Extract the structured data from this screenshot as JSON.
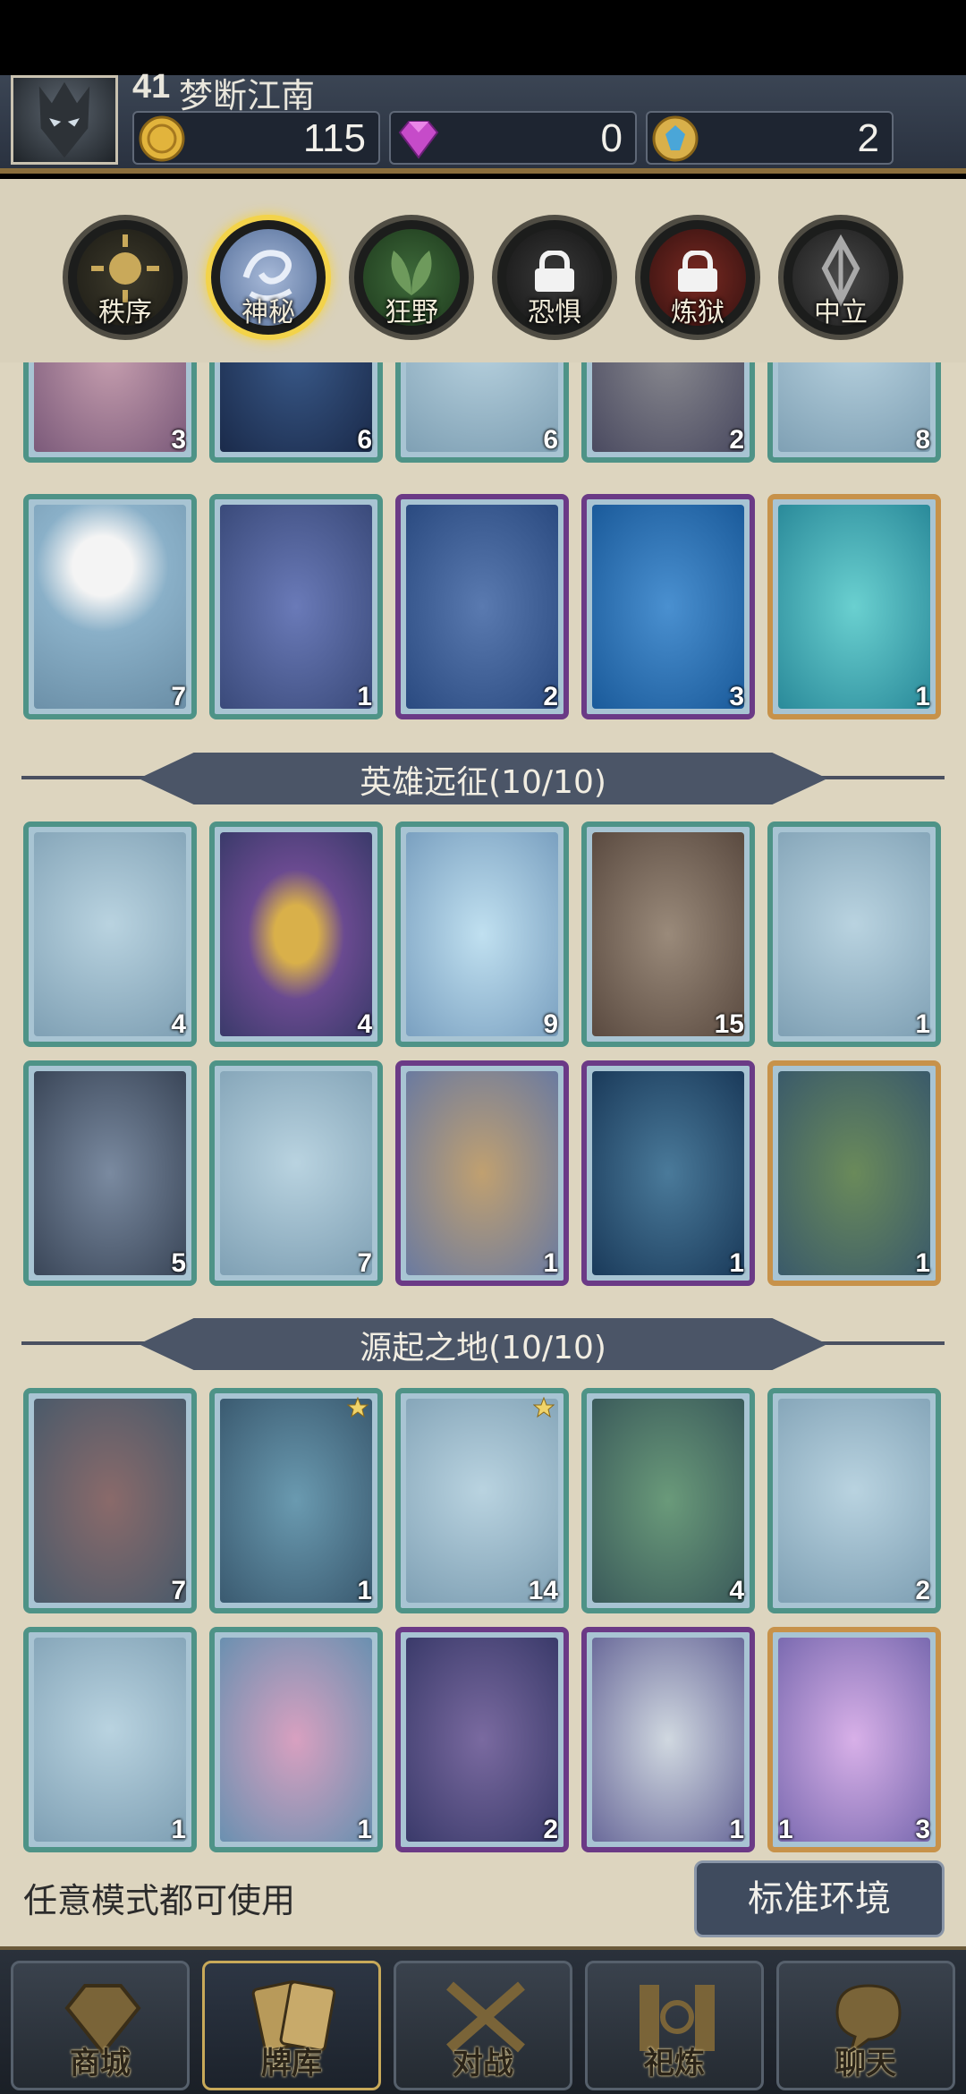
{
  "player": {
    "level": "41",
    "name": "梦断江南"
  },
  "resources": {
    "gold": "115",
    "gems": "0",
    "crystals": "2"
  },
  "factions": [
    {
      "label": "秩序",
      "locked": false,
      "active": false
    },
    {
      "label": "神秘",
      "locked": false,
      "active": true
    },
    {
      "label": "狂野",
      "locked": false,
      "active": false
    },
    {
      "label": "恐惧",
      "locked": true,
      "active": false
    },
    {
      "label": "炼狱",
      "locked": true,
      "active": false
    },
    {
      "label": "中立",
      "locked": false,
      "active": false
    }
  ],
  "partial_row": {
    "counts": [
      "3",
      "6",
      "6",
      "2",
      "8"
    ]
  },
  "set_prev_row2": {
    "counts": [
      "7",
      "1",
      "2",
      "3",
      "1"
    ],
    "rarity": [
      "common",
      "common",
      "epic",
      "epic",
      "legend"
    ]
  },
  "sections": [
    {
      "title": "英雄远征(10/10)",
      "rows": [
        {
          "counts": [
            "4",
            "4",
            "9",
            "15",
            "1"
          ],
          "rarity": [
            "common",
            "common",
            "common",
            "common",
            "common"
          ]
        },
        {
          "counts": [
            "5",
            "7",
            "1",
            "1",
            "1"
          ],
          "rarity": [
            "common",
            "common",
            "epic",
            "epic",
            "legend"
          ]
        }
      ]
    },
    {
      "title": "源起之地(10/10)",
      "rows": [
        {
          "counts": [
            "7",
            "1",
            "14",
            "4",
            "2"
          ],
          "rarity": [
            "common",
            "common",
            "common",
            "common",
            "common"
          ],
          "starred": [
            false,
            true,
            true,
            false,
            false
          ]
        },
        {
          "counts": [
            "1",
            "1",
            "2",
            "1",
            "3"
          ],
          "rarity": [
            "common",
            "common",
            "epic",
            "epic",
            "legend"
          ],
          "left_count_last": "1"
        }
      ]
    }
  ],
  "footer": {
    "note": "任意模式都可使用",
    "env_button": "标准环境"
  },
  "nav": [
    {
      "label": "商城",
      "icon": "shop-icon"
    },
    {
      "label": "牌库",
      "icon": "deck-icon"
    },
    {
      "label": "对战",
      "icon": "battle-icon"
    },
    {
      "label": "祀炼",
      "icon": "forge-icon"
    },
    {
      "label": "聊天",
      "icon": "chat-icon"
    }
  ],
  "colors": {
    "common_border": "#4e9387",
    "epic_border": "#6b3a86",
    "legend_border": "#c7924a",
    "active_faction": "#f3d34a"
  }
}
